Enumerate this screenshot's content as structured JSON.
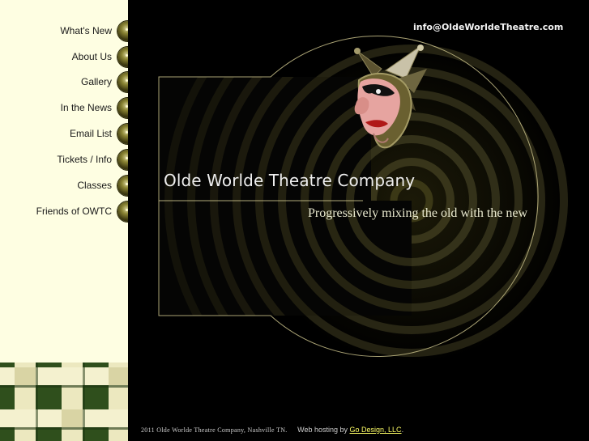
{
  "nav": {
    "items": [
      {
        "label": "What's New"
      },
      {
        "label": "About Us"
      },
      {
        "label": "Gallery"
      },
      {
        "label": "In the News"
      },
      {
        "label": "Email List"
      },
      {
        "label": "Tickets / Info"
      },
      {
        "label": "Classes"
      },
      {
        "label": "Friends of OWTC"
      }
    ]
  },
  "header": {
    "email": "info@OldeWorldeTheatre.com"
  },
  "hero": {
    "title": "Olde Worlde Theatre Company",
    "tagline": "Progressively mixing the old with the new"
  },
  "footer": {
    "copyright": "2011 Olde Worlde Theatre Company, Nashville TN.",
    "hosting_prefix": "Web hosting by",
    "hosting_link": "Go Design, LLC",
    "hosting_suffix": "."
  },
  "colors": {
    "sidebar_bg": "#fefee2",
    "main_bg": "#000000",
    "orb": "#8b8534",
    "accent_line": "#c8c08a",
    "link": "#ffff66"
  },
  "icons": [
    "nav-orb-icon",
    "jester-mask-icon",
    "woven-pattern-icon"
  ]
}
